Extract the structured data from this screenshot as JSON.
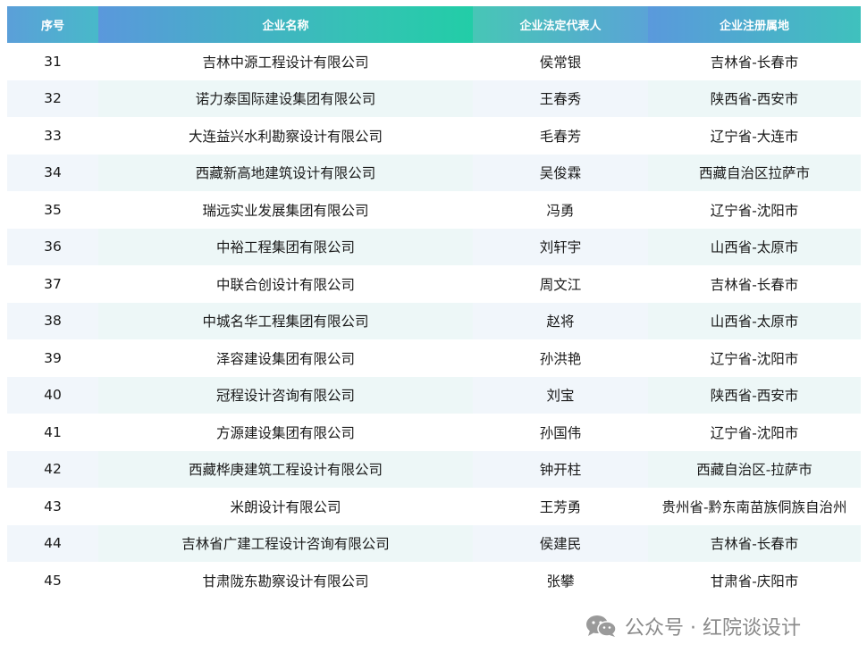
{
  "table": {
    "headers": [
      "序号",
      "企业名称",
      "企业法定代表人",
      "企业注册属地"
    ],
    "rows": [
      {
        "no": "31",
        "company": "吉林中源工程设计有限公司",
        "rep": "侯常银",
        "location": "吉林省-长春市"
      },
      {
        "no": "32",
        "company": "诺力泰国际建设集团有限公司",
        "rep": "王春秀",
        "location": "陕西省-西安市"
      },
      {
        "no": "33",
        "company": "大连益兴水利勘察设计有限公司",
        "rep": "毛春芳",
        "location": "辽宁省-大连市"
      },
      {
        "no": "34",
        "company": "西藏新高地建筑设计有限公司",
        "rep": "吴俊霖",
        "location": "西藏自治区拉萨市"
      },
      {
        "no": "35",
        "company": "瑞远实业发展集团有限公司",
        "rep": "冯勇",
        "location": "辽宁省-沈阳市"
      },
      {
        "no": "36",
        "company": "中裕工程集团有限公司",
        "rep": "刘轩宇",
        "location": "山西省-太原市"
      },
      {
        "no": "37",
        "company": "中联合创设计有限公司",
        "rep": "周文江",
        "location": "吉林省-长春市"
      },
      {
        "no": "38",
        "company": "中城名华工程集团有限公司",
        "rep": "赵将",
        "location": "山西省-太原市"
      },
      {
        "no": "39",
        "company": "泽容建设集团有限公司",
        "rep": "孙洪艳",
        "location": "辽宁省-沈阳市"
      },
      {
        "no": "40",
        "company": "冠程设计咨询有限公司",
        "rep": "刘宝",
        "location": "陕西省-西安市"
      },
      {
        "no": "41",
        "company": "方源建设集团有限公司",
        "rep": "孙国伟",
        "location": "辽宁省-沈阳市"
      },
      {
        "no": "42",
        "company": "西藏桦庚建筑工程设计有限公司",
        "rep": "钟开柱",
        "location": "西藏自治区-拉萨市"
      },
      {
        "no": "43",
        "company": "米朗设计有限公司",
        "rep": "王芳勇",
        "location": "贵州省-黔东南苗族侗族自治州"
      },
      {
        "no": "44",
        "company": "吉林省广建工程设计咨询有限公司",
        "rep": "侯建民",
        "location": "吉林省-长春市"
      },
      {
        "no": "45",
        "company": "甘肃陇东勘察设计有限公司",
        "rep": "张攀",
        "location": "甘肃省-庆阳市"
      }
    ]
  },
  "watermark": {
    "icon": "wechat-icon",
    "text": "公众号 · 红院谈设计"
  },
  "colors": {
    "header_text": "#ffffff",
    "alt_row": "#f1f6fb",
    "header_blue": "#5b9fd9",
    "header_teal": "#22cda7"
  }
}
